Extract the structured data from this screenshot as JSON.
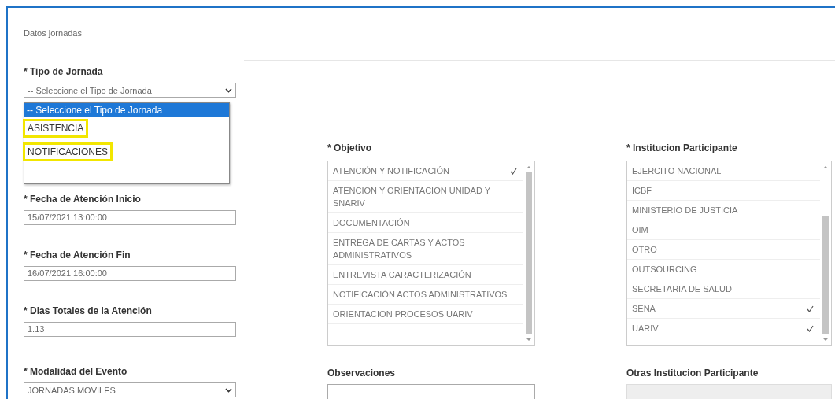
{
  "section_title": "Datos jornadas",
  "tipo_jornada": {
    "label": "* Tipo de Jornada",
    "value": "-- Seleccione el Tipo de Jornada",
    "open": true,
    "options": [
      {
        "label": "-- Seleccione el Tipo de Jornada",
        "selected": true,
        "highlighted": false
      },
      {
        "label": "ASISTENCIA",
        "selected": false,
        "highlighted": true
      },
      {
        "label": "NOTIFICACIONES",
        "selected": false,
        "highlighted": true
      }
    ]
  },
  "fecha_inicio": {
    "label": "* Fecha de Atención Inicio",
    "value": "15/07/2021 13:00:00"
  },
  "fecha_fin": {
    "label": "* Fecha de Atención Fin",
    "value": "16/07/2021 16:00:00"
  },
  "dias_totales": {
    "label": "* Dias Totales de la Atención",
    "value": "1.13"
  },
  "modalidad": {
    "label": "* Modalidad del Evento",
    "value": "JORNADAS MOVILES"
  },
  "objetivo": {
    "label": "* Objetivo",
    "items": [
      {
        "label": "ATENCIÓN Y NOTIFICACIÓN",
        "checked": true
      },
      {
        "label": "ATENCION Y ORIENTACION UNIDAD Y SNARIV",
        "checked": false
      },
      {
        "label": "DOCUMENTACIÓN",
        "checked": false
      },
      {
        "label": "ENTREGA DE CARTAS Y ACTOS ADMINISTRATIVOS",
        "checked": false
      },
      {
        "label": "ENTREVISTA CARACTERIZACIÓN",
        "checked": false
      },
      {
        "label": "NOTIFICACIÓN ACTOS ADMINISTRATIVOS",
        "checked": false
      },
      {
        "label": "ORIENTACION PROCESOS UARIV",
        "checked": false
      }
    ]
  },
  "observaciones": {
    "label": "Observaciones"
  },
  "institucion": {
    "label": "* Institucion Participante",
    "items": [
      {
        "label": "EJERCITO NACIONAL",
        "checked": false
      },
      {
        "label": "ICBF",
        "checked": false
      },
      {
        "label": "MINISTERIO DE JUSTICIA",
        "checked": false
      },
      {
        "label": "OIM",
        "checked": false
      },
      {
        "label": "OTRO",
        "checked": false
      },
      {
        "label": "OUTSOURCING",
        "checked": false
      },
      {
        "label": "SECRETARIA DE SALUD",
        "checked": false
      },
      {
        "label": "SENA",
        "checked": true
      },
      {
        "label": "UARIV",
        "checked": true
      }
    ]
  },
  "otras_institucion": {
    "label": "Otras Institucion Participante",
    "disabled": true
  }
}
